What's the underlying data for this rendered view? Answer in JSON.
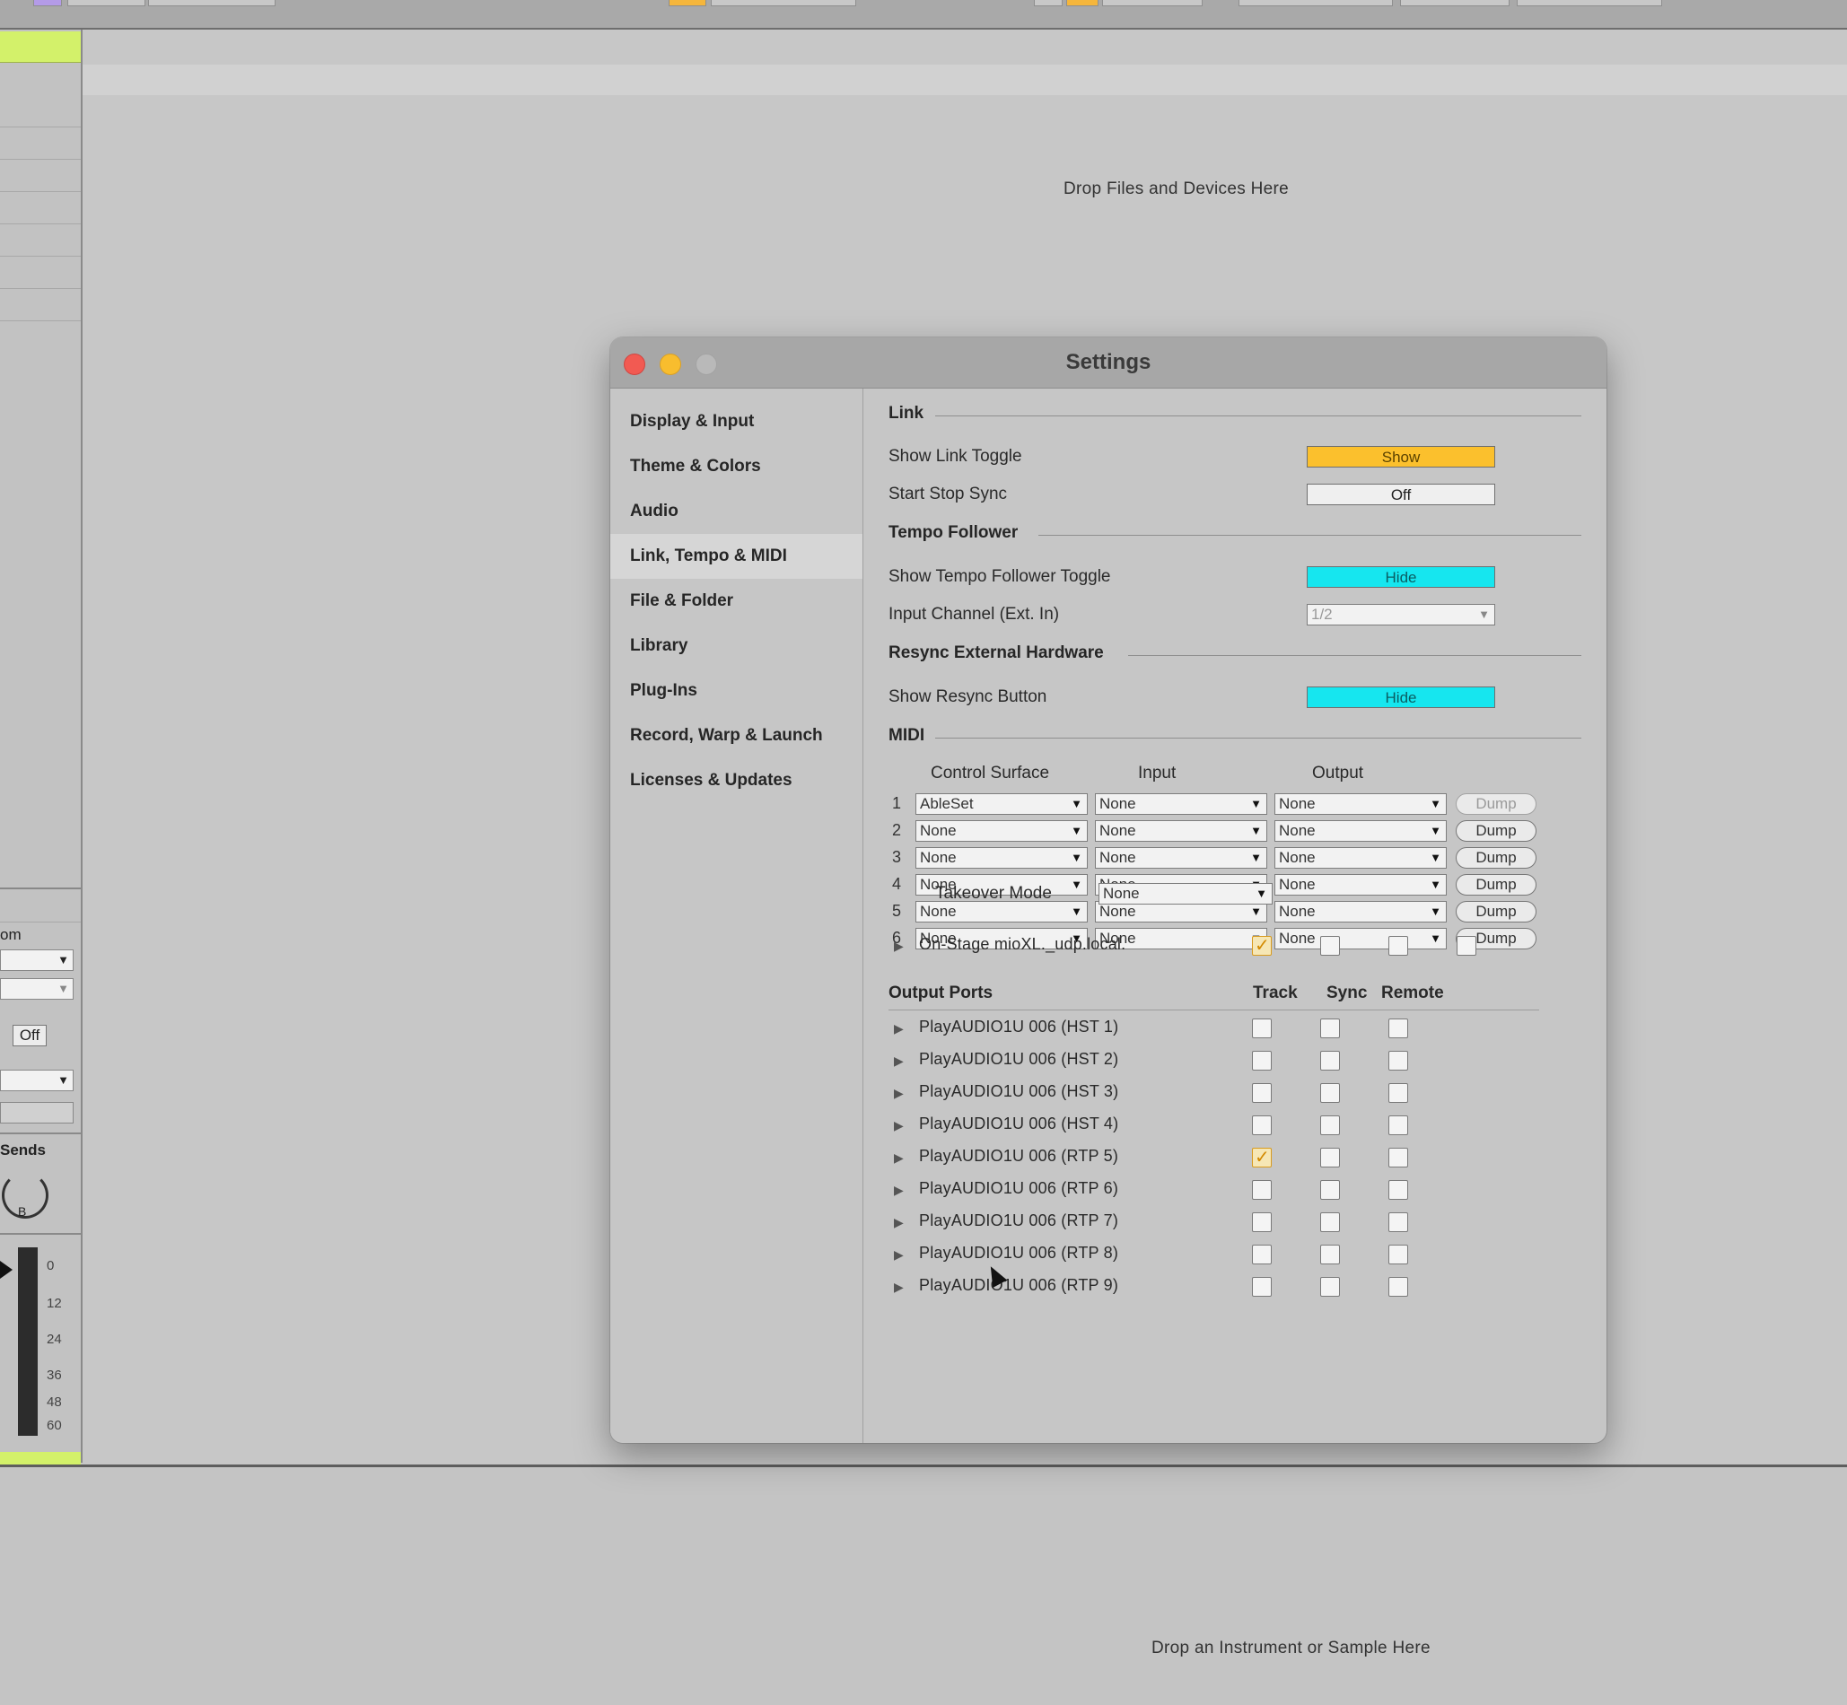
{
  "background": {
    "drop_files_text": "Drop Files and Devices Here",
    "drop_instrument_text": "Drop an Instrument or Sample Here",
    "left_mixer": {
      "label_partial": "om",
      "off_label": "Off",
      "sends_label": "Sends",
      "knob_letter": "B",
      "meter_scale": [
        "0",
        "12",
        "24",
        "36",
        "48",
        "60"
      ]
    },
    "accent_green": "#d3f16a"
  },
  "dialog": {
    "title": "Settings",
    "sidebar": {
      "items": [
        {
          "label": "Display & Input"
        },
        {
          "label": "Theme & Colors"
        },
        {
          "label": "Audio"
        },
        {
          "label": "Link, Tempo & MIDI",
          "active": true
        },
        {
          "label": "File & Folder"
        },
        {
          "label": "Library"
        },
        {
          "label": "Plug-Ins"
        },
        {
          "label": "Record, Warp & Launch"
        },
        {
          "label": "Licenses & Updates"
        }
      ]
    },
    "link": {
      "heading": "Link",
      "show_link_toggle_label": "Show Link Toggle",
      "show_link_toggle_value": "Show",
      "start_stop_sync_label": "Start Stop Sync",
      "start_stop_sync_value": "Off"
    },
    "tempo_follower": {
      "heading": "Tempo Follower",
      "show_toggle_label": "Show Tempo Follower Toggle",
      "show_toggle_value": "Hide",
      "input_channel_label": "Input Channel (Ext. In)",
      "input_channel_value": "1/2"
    },
    "resync": {
      "heading": "Resync External Hardware",
      "show_button_label": "Show Resync Button",
      "show_button_value": "Hide"
    },
    "midi": {
      "heading": "MIDI",
      "col_control_surface": "Control Surface",
      "col_input": "Input",
      "col_output": "Output",
      "rows": [
        {
          "num": "1",
          "surface": "AbleSet",
          "input": "None",
          "output": "None",
          "dump": "Dump",
          "dump_enabled": false
        },
        {
          "num": "2",
          "surface": "None",
          "input": "None",
          "output": "None",
          "dump": "Dump",
          "dump_enabled": true
        },
        {
          "num": "3",
          "surface": "None",
          "input": "None",
          "output": "None",
          "dump": "Dump",
          "dump_enabled": true
        },
        {
          "num": "4",
          "surface": "None",
          "input": "None",
          "output": "None",
          "dump": "Dump",
          "dump_enabled": true
        },
        {
          "num": "5",
          "surface": "None",
          "input": "None",
          "output": "None",
          "dump": "Dump",
          "dump_enabled": true
        },
        {
          "num": "6",
          "surface": "None",
          "input": "None",
          "output": "None",
          "dump": "Dump",
          "dump_enabled": true
        }
      ],
      "takeover_label": "Takeover Mode",
      "takeover_value": "None",
      "input_device": {
        "label": "On-Stage mioXL._udp.local.",
        "checks": [
          true,
          false,
          false,
          false
        ]
      }
    },
    "output_ports": {
      "heading": "Output Ports",
      "col_track": "Track",
      "col_sync": "Sync",
      "col_remote": "Remote",
      "ports": [
        {
          "label": "PlayAUDIO1U 006 (HST 1)",
          "track": false,
          "sync": false,
          "remote": false
        },
        {
          "label": "PlayAUDIO1U 006 (HST 2)",
          "track": false,
          "sync": false,
          "remote": false
        },
        {
          "label": "PlayAUDIO1U 006 (HST 3)",
          "track": false,
          "sync": false,
          "remote": false
        },
        {
          "label": "PlayAUDIO1U 006 (HST 4)",
          "track": false,
          "sync": false,
          "remote": false
        },
        {
          "label": "PlayAUDIO1U 006 (RTP 5)",
          "track": true,
          "sync": false,
          "remote": false
        },
        {
          "label": "PlayAUDIO1U 006 (RTP 6)",
          "track": false,
          "sync": false,
          "remote": false
        },
        {
          "label": "PlayAUDIO1U 006 (RTP 7)",
          "track": false,
          "sync": false,
          "remote": false
        },
        {
          "label": "PlayAUDIO1U 006 (RTP 8)",
          "track": false,
          "sync": false,
          "remote": false
        },
        {
          "label": "PlayAUDIO1U 006 (RTP 9)",
          "track": false,
          "sync": false,
          "remote": false
        }
      ]
    },
    "colors": {
      "show_yellow": "#fbc02d",
      "hide_cyan": "#16e6ef",
      "check_orange": "#d38a00"
    }
  }
}
